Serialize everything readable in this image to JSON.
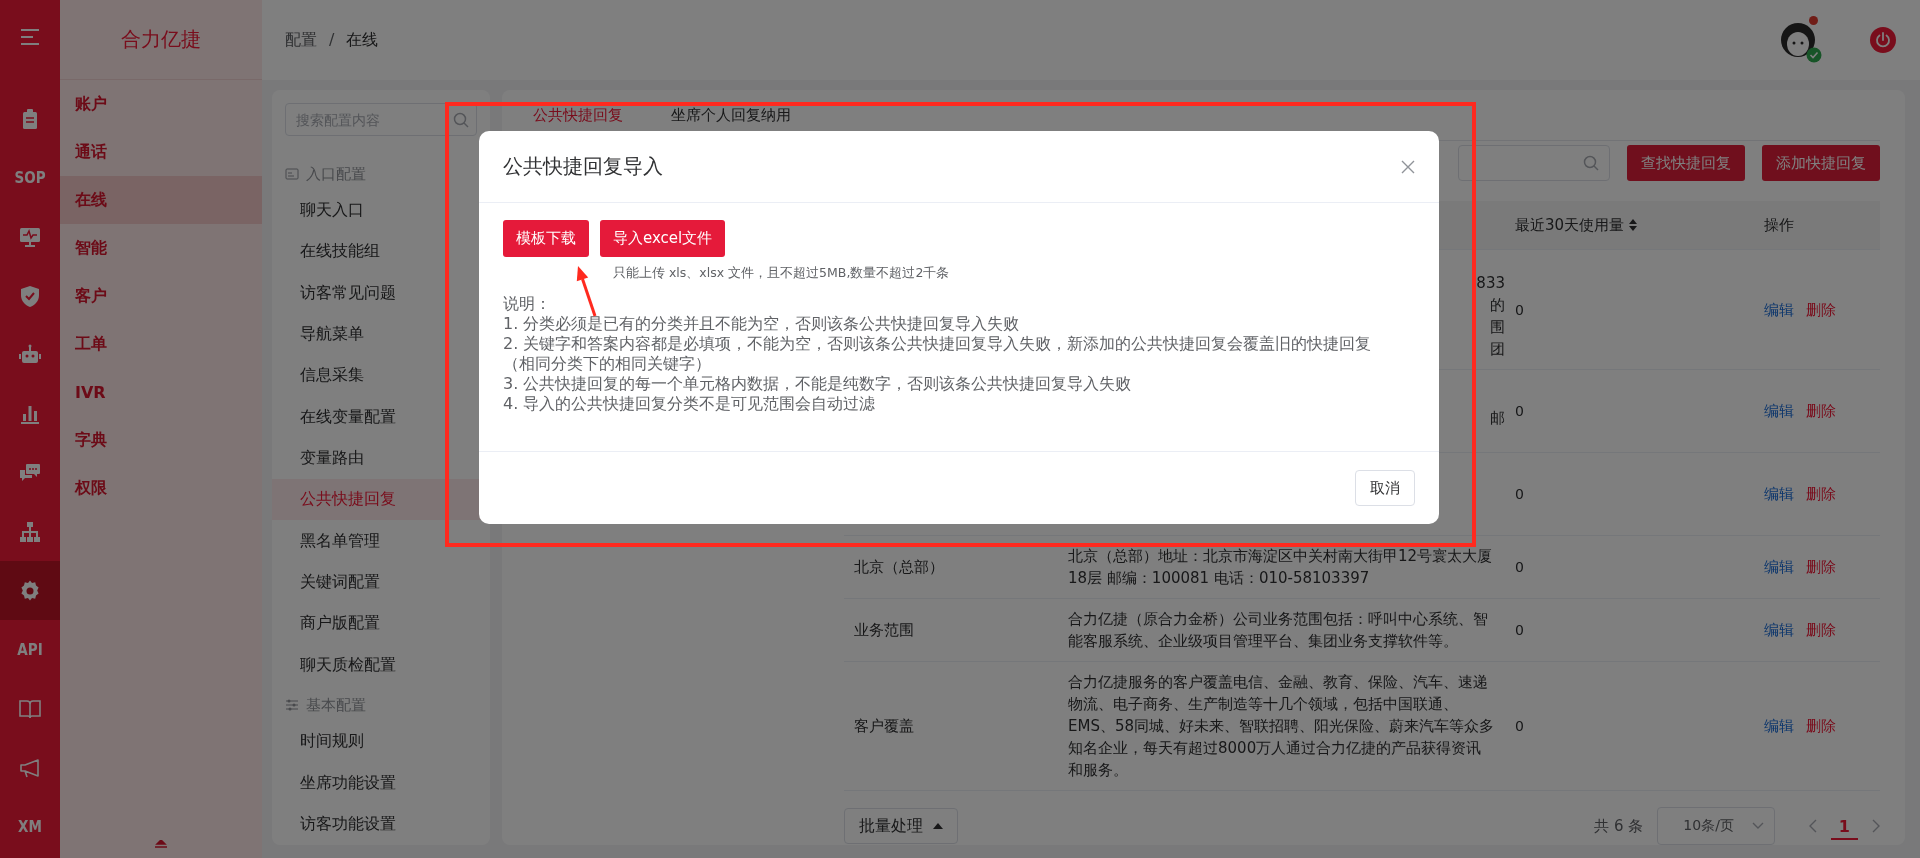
{
  "rail": {
    "items": [
      {
        "kind": "icon",
        "selected": false
      },
      {
        "kind": "icon",
        "selected": false
      },
      {
        "kind": "text",
        "label": "SOP",
        "selected": false
      },
      {
        "kind": "icon",
        "selected": false
      },
      {
        "kind": "icon",
        "selected": false
      },
      {
        "kind": "icon",
        "selected": false
      },
      {
        "kind": "icon",
        "selected": false
      },
      {
        "kind": "icon",
        "selected": false
      },
      {
        "kind": "icon",
        "selected": false
      },
      {
        "kind": "icon",
        "selected": true
      },
      {
        "kind": "text",
        "label": "API",
        "selected": false
      },
      {
        "kind": "icon",
        "selected": false
      },
      {
        "kind": "icon",
        "selected": false
      },
      {
        "kind": "text",
        "label": "XM",
        "selected": false
      }
    ]
  },
  "nav": {
    "title": "合力亿捷",
    "items": [
      {
        "label": "账户",
        "selected": false
      },
      {
        "label": "通话",
        "selected": false
      },
      {
        "label": "在线",
        "selected": true
      },
      {
        "label": "智能",
        "selected": false
      },
      {
        "label": "客户",
        "selected": false
      },
      {
        "label": "工单",
        "selected": false
      },
      {
        "label": "IVR",
        "selected": false
      },
      {
        "label": "字典",
        "selected": false
      },
      {
        "label": "权限",
        "selected": false
      }
    ]
  },
  "header": {
    "breadcrumb": [
      {
        "label": "配置"
      },
      {
        "label": "在线"
      }
    ],
    "separator": "/",
    "notification": true,
    "online": true
  },
  "config_menu": {
    "search": {
      "placeholder": "搜索配置内容"
    },
    "groups": [
      {
        "title": "入口配置",
        "items": [
          {
            "label": "聊天入口",
            "selected": false
          },
          {
            "label": "在线技能组",
            "selected": false
          },
          {
            "label": "访客常见问题",
            "selected": false
          },
          {
            "label": "导航菜单",
            "selected": false
          },
          {
            "label": "信息采集",
            "selected": false
          },
          {
            "label": "在线变量配置",
            "selected": false
          },
          {
            "label": "变量路由",
            "selected": false
          },
          {
            "label": "公共快捷回复",
            "selected": true
          },
          {
            "label": "黑名单管理",
            "selected": false
          },
          {
            "label": "关键词配置",
            "selected": false
          },
          {
            "label": "商户版配置",
            "selected": false
          },
          {
            "label": "聊天质检配置",
            "selected": false
          }
        ]
      },
      {
        "title": "基本配置",
        "items": [
          {
            "label": "时间规则",
            "selected": false
          },
          {
            "label": "坐席功能设置",
            "selected": false
          },
          {
            "label": "访客功能设置",
            "selected": false
          }
        ]
      }
    ]
  },
  "main": {
    "tabs": [
      {
        "label": "公共快捷回复",
        "selected": true
      },
      {
        "label": "坐席个人回复纳用",
        "selected": false
      }
    ],
    "buttons": [
      "查找快捷回复",
      "添加快捷回复"
    ],
    "table": {
      "columns": [
        {
          "label": "最近30天使用量",
          "sortable": true
        },
        {
          "label": "操作",
          "sortable": false
        }
      ],
      "rows": [
        {
          "answer_fragments": [
            "833",
            "的",
            "围",
            "团"
          ],
          "usage": "0",
          "actions": [
            "编辑",
            "删除"
          ]
        },
        {
          "answer_fragments": [
            "邮"
          ],
          "usage": "0",
          "actions": [
            "编辑",
            "删除"
          ]
        },
        {
          "usage": "0",
          "actions": [
            "编辑",
            "删除"
          ]
        },
        {
          "category": "北京（总部）",
          "answer": "北京（总部）地址：北京市海淀区中关村南大街甲12号寰太大厦18层 邮编：100081 电话：010-58103397",
          "usage": "0",
          "actions": [
            "编辑",
            "删除"
          ]
        },
        {
          "category": "业务范围",
          "answer": "合力亿捷（原合力金桥）公司业务范围包括：呼叫中心系统、智能客服系统、企业级项目管理平台、集团业务支撑软件等。",
          "usage": "0",
          "actions": [
            "编辑",
            "删除"
          ]
        },
        {
          "category": "客户覆盖",
          "answer": "合力亿捷服务的客户覆盖电信、金融、教育、保险、汽车、速递物流、电子商务、生产制造等十几个领域，包括中国联通、EMS、58同城、好未来、智联招聘、阳光保险、蔚来汽车等众多知名企业，每天有超过8000万人通过合力亿捷的产品获得资讯和服务。",
          "usage": "0",
          "actions": [
            "编辑",
            "删除"
          ]
        }
      ]
    },
    "footer": {
      "batch_button": "批量处理",
      "total": "共 6 条",
      "page_size": "10条/页",
      "pages": [
        {
          "label": "1",
          "selected": true
        }
      ]
    }
  },
  "modal": {
    "title": "公共快捷回复导入",
    "buttons": [
      "模板下载",
      "导入excel文件"
    ],
    "hint": "只能上传 xls、xlsx 文件，且不超过5MB,数量不超过2千条",
    "notes_title": "说明：",
    "notes": [
      "1. 分类必须是已有的分类并且不能为空，否则该条公共快捷回复导入失败",
      "2. 关键字和答案内容都是必填项，不能为空，否则该条公共快捷回复导入失败，新添加的公共快捷回复会覆盖旧的快捷回复（相同分类下的相同关键字）",
      "3. 公共快捷回复的每一个单元格内数据，不能是纯数字，否则该条公共快捷回复导入失败",
      "4. 导入的公共快捷回复分类不是可见范围会自动过滤"
    ],
    "cancel": "取消"
  }
}
